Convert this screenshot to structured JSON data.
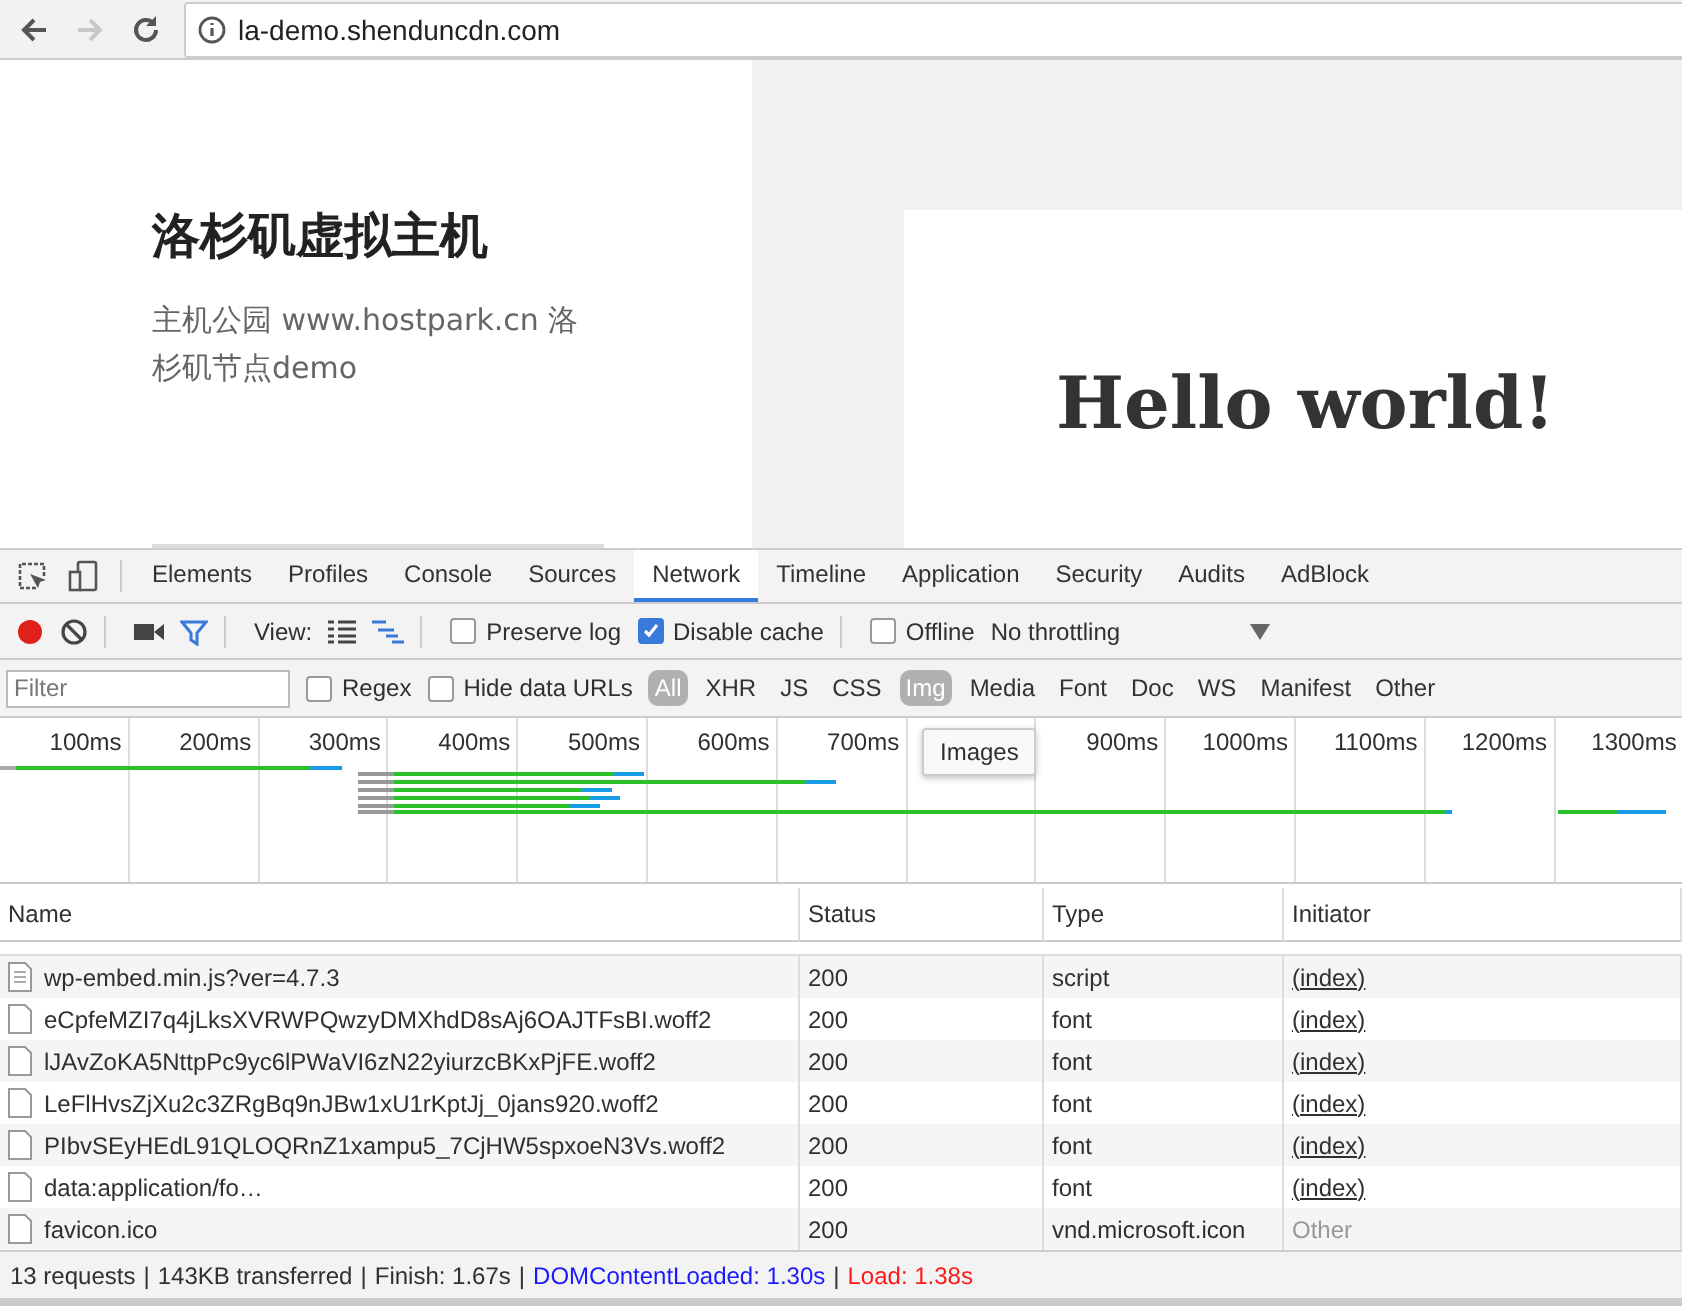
{
  "browser": {
    "url": "la-demo.shenduncdn.com",
    "forward_disabled": true
  },
  "page": {
    "site_title": "洛杉矶虚拟主机",
    "site_description": "主机公园 www.hostpark.cn 洛杉矶节点demo",
    "heading": "Hello world!"
  },
  "devtools": {
    "tabs": [
      {
        "label": "Elements",
        "selected": false
      },
      {
        "label": "Profiles",
        "selected": false
      },
      {
        "label": "Console",
        "selected": false
      },
      {
        "label": "Sources",
        "selected": false
      },
      {
        "label": "Network",
        "selected": true
      },
      {
        "label": "Timeline",
        "selected": false
      },
      {
        "label": "Application",
        "selected": false
      },
      {
        "label": "Security",
        "selected": false
      },
      {
        "label": "Audits",
        "selected": false
      },
      {
        "label": "AdBlock",
        "selected": false
      }
    ],
    "toolbar": {
      "recording": true,
      "filter_on": true,
      "view_label": "View:",
      "preserve_log": {
        "label": "Preserve log",
        "checked": false
      },
      "disable_cache": {
        "label": "Disable cache",
        "checked": true
      },
      "offline": {
        "label": "Offline",
        "checked": false
      },
      "throttling": "No throttling"
    },
    "filter": {
      "placeholder": "Filter",
      "regex": {
        "label": "Regex",
        "checked": false
      },
      "hide_data_urls": {
        "label": "Hide data URLs",
        "checked": false
      },
      "types": [
        {
          "label": "All",
          "selected": true
        },
        {
          "label": "XHR",
          "selected": false
        },
        {
          "label": "JS",
          "selected": false
        },
        {
          "label": "CSS",
          "selected": false
        },
        {
          "label": "Img",
          "selected": true
        },
        {
          "label": "Media",
          "selected": false
        },
        {
          "label": "Font",
          "selected": false
        },
        {
          "label": "Doc",
          "selected": false
        },
        {
          "label": "WS",
          "selected": false
        },
        {
          "label": "Manifest",
          "selected": false
        },
        {
          "label": "Other",
          "selected": false
        }
      ]
    },
    "overview": {
      "ticks": [
        {
          "label": "100ms"
        },
        {
          "label": "200ms"
        },
        {
          "label": "300ms"
        },
        {
          "label": "400ms"
        },
        {
          "label": "500ms"
        },
        {
          "label": "600ms"
        },
        {
          "label": "700ms"
        },
        {
          "covered": true
        },
        {
          "label": "900ms"
        },
        {
          "label": "1000ms"
        },
        {
          "label": "1100ms"
        },
        {
          "label": "1200ms"
        },
        {
          "label": "1300ms"
        }
      ],
      "tooltip": "Images"
    },
    "table": {
      "columns": [
        "Name",
        "Status",
        "Type",
        "Initiator"
      ],
      "rows": [
        {
          "kind": "script",
          "name": "wp-embed.min.js?ver=4.7.3",
          "status": "200",
          "type": "script",
          "initiator": "(index)",
          "initiator_link": true
        },
        {
          "kind": "file",
          "name": "eCpfeMZI7q4jLksXVRWPQwzyDMXhdD8sAj6OAJTFsBI.woff2",
          "status": "200",
          "type": "font",
          "initiator": "(index)",
          "initiator_link": true
        },
        {
          "kind": "file",
          "name": "lJAvZoKA5NttpPc9yc6lPWaVI6zN22yiurzcBKxPjFE.woff2",
          "status": "200",
          "type": "font",
          "initiator": "(index)",
          "initiator_link": true
        },
        {
          "kind": "file",
          "name": "LeFlHvsZjXu2c3ZRgBq9nJBw1xU1rKptJj_0jans920.woff2",
          "status": "200",
          "type": "font",
          "initiator": "(index)",
          "initiator_link": true
        },
        {
          "kind": "file",
          "name": "PIbvSEyHEdL91QLOQRnZ1xampu5_7CjHW5spxoeN3Vs.woff2",
          "status": "200",
          "type": "font",
          "initiator": "(index)",
          "initiator_link": true
        },
        {
          "kind": "file",
          "name": "data:application/fo…",
          "status": "200",
          "type": "font",
          "initiator": "(index)",
          "initiator_link": true
        },
        {
          "kind": "file",
          "name": "favicon.ico",
          "status": "200",
          "type": "vnd.microsoft.icon",
          "initiator": "Other",
          "initiator_link": false
        }
      ]
    },
    "status_bar": {
      "separator": "|",
      "parts": [
        {
          "kind": "plain",
          "text": "13 requests"
        },
        {
          "kind": "plain",
          "text": "143KB transferred"
        },
        {
          "kind": "plain",
          "text": "Finish: 1.67s"
        },
        {
          "kind": "dom",
          "text": "DOMContentLoaded: 1.30s"
        },
        {
          "kind": "load",
          "text": "Load: 1.38s"
        }
      ]
    }
  }
}
